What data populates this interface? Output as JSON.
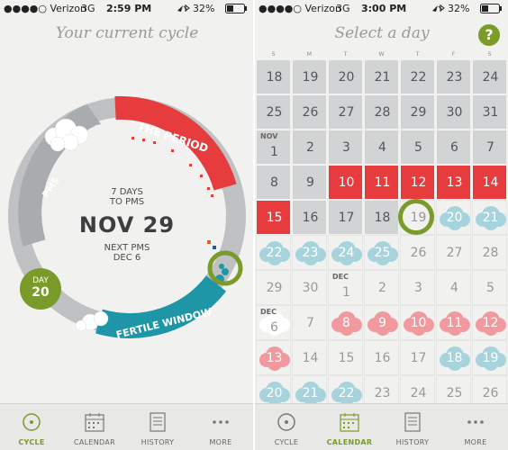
{
  "status_left": {
    "carrier": "●●●●○ Verizon",
    "network": "3G",
    "time": "2:59 PM",
    "battery": "32%"
  },
  "status_right": {
    "carrier": "●●●●○ Verizon",
    "network": "3G",
    "time": "3:00 PM",
    "battery": "32%"
  },
  "cycle_screen": {
    "title": "Your current cycle",
    "days_to_pms": "7 DAYS",
    "to_pms": "TO PMS",
    "date": "NOV 29",
    "next_pms_label": "NEXT PMS",
    "next_pms_date": "DEC 6",
    "day_label": "DAY",
    "day_number": "20",
    "arc_period": "THE PERIOD",
    "arc_fertile": "FERTILE WINDOW",
    "arc_pms": "PMS"
  },
  "calendar_screen": {
    "title": "Select a day",
    "help": "?",
    "weekdays": [
      "S",
      "M",
      "T",
      "W",
      "T",
      "F",
      "S"
    ],
    "rows": [
      [
        {
          "n": "18",
          "s": "grey"
        },
        {
          "n": "19",
          "s": "grey"
        },
        {
          "n": "20",
          "s": "grey"
        },
        {
          "n": "21",
          "s": "grey"
        },
        {
          "n": "22",
          "s": "grey"
        },
        {
          "n": "23",
          "s": "grey"
        },
        {
          "n": "24",
          "s": "grey"
        }
      ],
      [
        {
          "n": "25",
          "s": "grey"
        },
        {
          "n": "26",
          "s": "grey"
        },
        {
          "n": "27",
          "s": "grey"
        },
        {
          "n": "28",
          "s": "grey"
        },
        {
          "n": "29",
          "s": "grey"
        },
        {
          "n": "30",
          "s": "grey"
        },
        {
          "n": "31",
          "s": "grey"
        }
      ],
      [
        {
          "n": "1",
          "s": "grey",
          "m": "NOV"
        },
        {
          "n": "2",
          "s": "grey"
        },
        {
          "n": "3",
          "s": "grey"
        },
        {
          "n": "4",
          "s": "grey"
        },
        {
          "n": "5",
          "s": "grey"
        },
        {
          "n": "6",
          "s": "grey"
        },
        {
          "n": "7",
          "s": "grey"
        }
      ],
      [
        {
          "n": "8",
          "s": "grey"
        },
        {
          "n": "9",
          "s": "grey"
        },
        {
          "n": "10",
          "s": "period"
        },
        {
          "n": "11",
          "s": "period"
        },
        {
          "n": "12",
          "s": "period"
        },
        {
          "n": "13",
          "s": "period"
        },
        {
          "n": "14",
          "s": "period"
        }
      ],
      [
        {
          "n": "15",
          "s": "period"
        },
        {
          "n": "16",
          "s": "grey"
        },
        {
          "n": "17",
          "s": "grey"
        },
        {
          "n": "18",
          "s": "grey"
        },
        {
          "n": "19",
          "s": "today"
        },
        {
          "n": "20",
          "s": "fertile"
        },
        {
          "n": "21",
          "s": "fertile"
        }
      ],
      [
        {
          "n": "22",
          "s": "fertile"
        },
        {
          "n": "23",
          "s": "fertile"
        },
        {
          "n": "24",
          "s": "fertile"
        },
        {
          "n": "25",
          "s": "fertile"
        },
        {
          "n": "26",
          "s": "light"
        },
        {
          "n": "27",
          "s": "light"
        },
        {
          "n": "28",
          "s": "light"
        }
      ],
      [
        {
          "n": "29",
          "s": "light"
        },
        {
          "n": "30",
          "s": "light"
        },
        {
          "n": "1",
          "s": "light",
          "m": "DEC"
        },
        {
          "n": "2",
          "s": "light"
        },
        {
          "n": "3",
          "s": "light"
        },
        {
          "n": "4",
          "s": "light"
        },
        {
          "n": "5",
          "s": "light"
        }
      ],
      [
        {
          "n": "6",
          "s": "pms",
          "m": "DEC"
        },
        {
          "n": "7",
          "s": "light"
        },
        {
          "n": "8",
          "s": "pink"
        },
        {
          "n": "9",
          "s": "pink"
        },
        {
          "n": "10",
          "s": "pink"
        },
        {
          "n": "11",
          "s": "pink"
        },
        {
          "n": "12",
          "s": "pink"
        }
      ],
      [
        {
          "n": "13",
          "s": "pink"
        },
        {
          "n": "14",
          "s": "light"
        },
        {
          "n": "15",
          "s": "light"
        },
        {
          "n": "16",
          "s": "light"
        },
        {
          "n": "17",
          "s": "light"
        },
        {
          "n": "18",
          "s": "fertile"
        },
        {
          "n": "19",
          "s": "fertile"
        }
      ],
      [
        {
          "n": "20",
          "s": "fertile"
        },
        {
          "n": "21",
          "s": "fertile"
        },
        {
          "n": "22",
          "s": "fertile"
        },
        {
          "n": "23",
          "s": "light"
        },
        {
          "n": "24",
          "s": "light"
        },
        {
          "n": "25",
          "s": "light"
        },
        {
          "n": "26",
          "s": "light"
        }
      ]
    ]
  },
  "tabs": [
    {
      "label": "CYCLE",
      "icon": "cycle-icon"
    },
    {
      "label": "CALENDAR",
      "icon": "calendar-icon"
    },
    {
      "label": "HISTORY",
      "icon": "history-icon"
    },
    {
      "label": "MORE",
      "icon": "more-icon"
    }
  ],
  "colors": {
    "period": "#e63c3e",
    "fertile": "#1f96a8",
    "accent": "#7a9a2a",
    "grey": "#d2d3d5",
    "pink": "#f09a9f",
    "lightblue": "#a7d3dd"
  }
}
